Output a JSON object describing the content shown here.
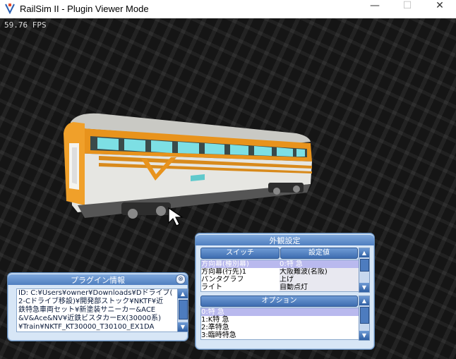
{
  "window": {
    "app_icon": "railsim-icon",
    "title": "RailSim II - Plugin Viewer Mode",
    "minimize": "—",
    "maximize": "☐",
    "close": "✕"
  },
  "viewport": {
    "fps": "59.76 FPS",
    "model": "train-car-orange-white",
    "cursor": "arrow-cursor"
  },
  "appearance_panel": {
    "title": "外観設定",
    "switch_table": {
      "headers": [
        "スイッチ",
        "設定値"
      ],
      "rows": [
        {
          "switch": "方向幕(種別幕)",
          "value": "0:特 急",
          "selected": true
        },
        {
          "switch": "方向幕(行先)1",
          "value": "大阪難波(名阪)",
          "selected": false
        },
        {
          "switch": "パンタグラフ",
          "value": "上げ",
          "selected": false
        },
        {
          "switch": "ライト",
          "value": "自動点灯",
          "selected": false
        }
      ]
    },
    "option_table": {
      "header": "オプション",
      "items": [
        {
          "label": "0:特 急",
          "selected": true
        },
        {
          "label": "1:K特 急",
          "selected": false
        },
        {
          "label": "2:準特急",
          "selected": false
        },
        {
          "label": "3:臨時特急",
          "selected": false
        }
      ]
    }
  },
  "plugin_panel": {
    "title": "プラグイン情報",
    "close": "⊗",
    "lines": [
      "ID: C:¥Users¥owner¥Downloads¥Dドライブ(",
      "2-Cドライブ移設)¥開発部ストック¥NKTF¥近",
      "鉄特急車両セット¥新塗装サニーカー&ACE",
      "&V&Ace&NV¥近鉄ビスタカーEX(30000系)",
      "¥Train¥NKTF_KT30000_T30100_EX1DA"
    ]
  },
  "colors": {
    "viewport_bg": "#151515",
    "panel_bg": "#d7e6f6",
    "header_blue": "#3e6db0",
    "selected_row": "#b9b9ee",
    "train_orange": "#e8931c"
  }
}
